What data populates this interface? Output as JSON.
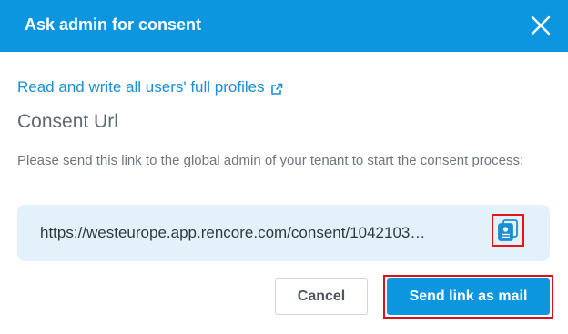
{
  "dialog": {
    "title": "Ask admin for consent",
    "permission_link": "Read and write all users' full profiles",
    "section_title": "Consent Url",
    "description": "Please send this link to the global admin of your tenant to start the consent process:",
    "consent_url": "https://westeurope.app.rencore.com/consent/1042103…",
    "cancel_label": "Cancel",
    "send_label": "Send link as mail",
    "icons": {
      "close": "close-icon",
      "external": "external-link-icon",
      "copy": "copy-icon"
    },
    "colors": {
      "header": "#0b96df",
      "link": "#1a8fd6",
      "url_box": "#e3f1fb",
      "highlight": "#e8141c"
    }
  }
}
